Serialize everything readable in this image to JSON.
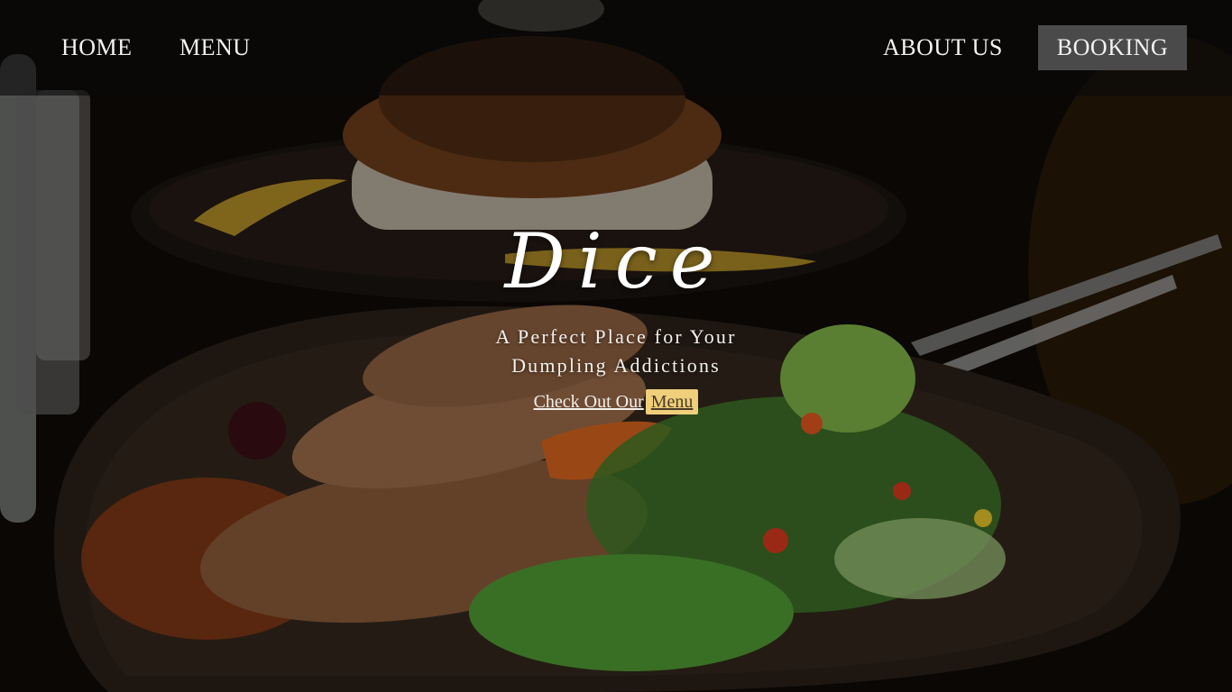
{
  "nav": {
    "home_label": "HOME",
    "menu_label": "MENU",
    "about_label": "ABOUT US",
    "booking_label": "BOOKING"
  },
  "hero": {
    "logo_text": "Dice",
    "tagline": "A Perfect Place for Your Dumpling Addictions",
    "cta_text": "Check Out Our",
    "cta_link": "Menu"
  },
  "colors": {
    "navbar_bg": "#0a0a0a",
    "booking_bg": "#4a4a4a",
    "cta_highlight": "#f0cf7a",
    "text": "#ffffff"
  },
  "background": {
    "description_icon": "food-photo"
  }
}
